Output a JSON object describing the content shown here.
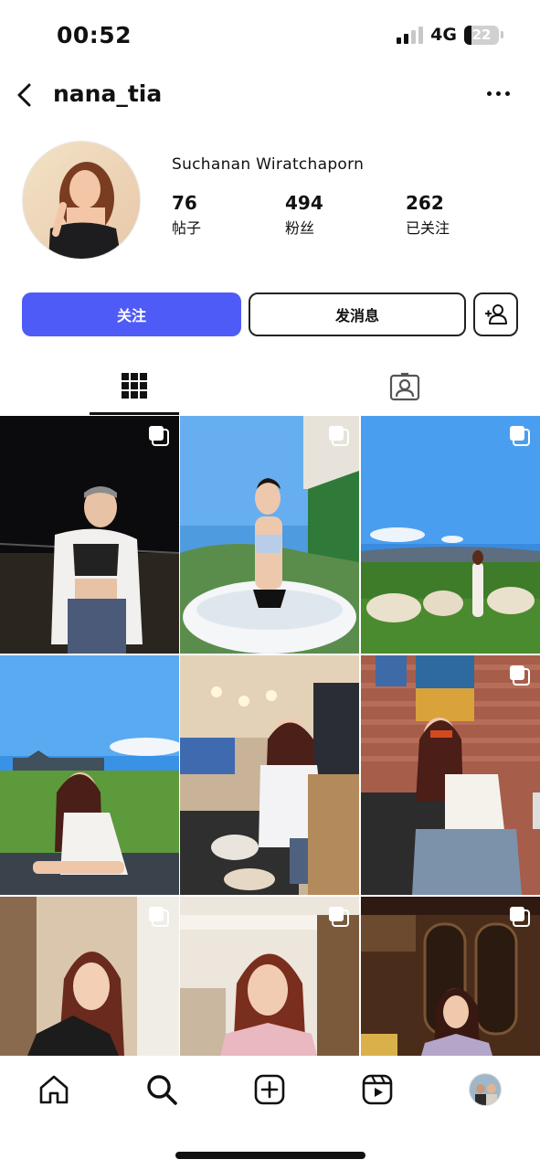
{
  "status": {
    "time": "00:52",
    "network": "4G",
    "battery": "22",
    "battery_level": 0.22
  },
  "header": {
    "username": "nana_tia"
  },
  "profile": {
    "full_name": "Suchanan Wiratchaporn",
    "stats": [
      {
        "value": "76",
        "label": "帖子"
      },
      {
        "value": "494",
        "label": "粉丝"
      },
      {
        "value": "262",
        "label": "已关注"
      }
    ]
  },
  "actions": {
    "follow": "关注",
    "message": "发消息"
  },
  "tabs": [
    {
      "icon": "grid-icon"
    },
    {
      "icon": "tagged-icon"
    }
  ],
  "colors": {
    "follow_button": "#4e5bf7",
    "text": "#111111",
    "background": "#ffffff"
  },
  "tab_bar": [
    {
      "icon": "home-icon"
    },
    {
      "icon": "search-icon"
    },
    {
      "icon": "create-icon"
    },
    {
      "icon": "reels-icon"
    },
    {
      "icon": "profile-avatar"
    }
  ]
}
